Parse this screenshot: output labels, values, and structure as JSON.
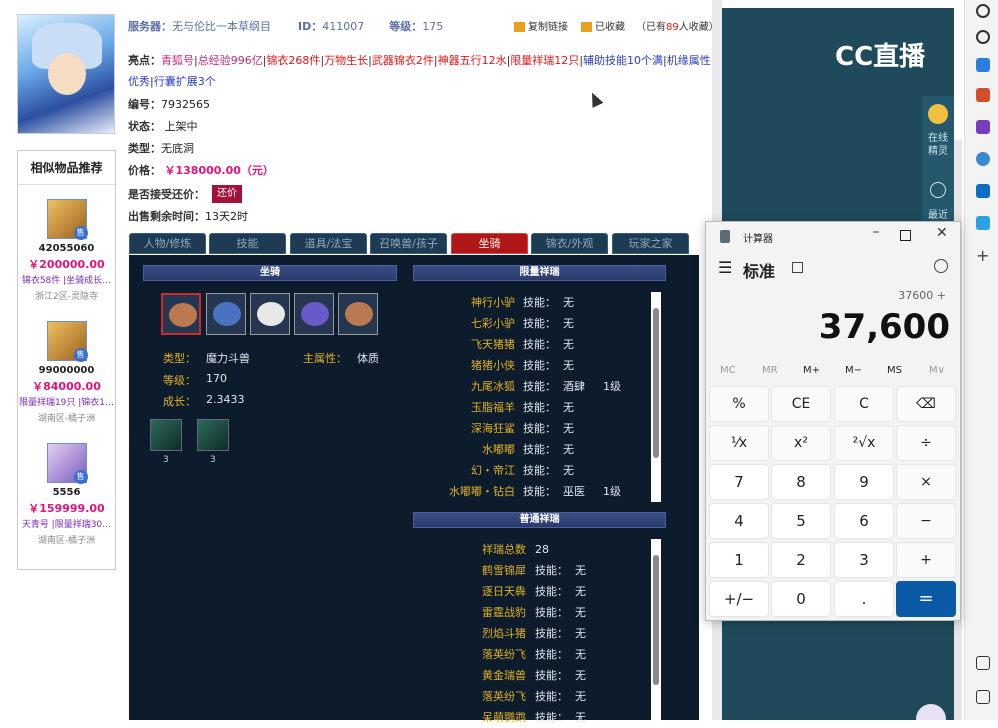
{
  "seller": {
    "server_label": "服务器：",
    "server": "无与伦比一本草纲目",
    "id_label": "ID：",
    "id": "411007",
    "level_label": "等级：",
    "level": "175",
    "copy_link": "复制链接",
    "favorited": "已收藏",
    "fav_count_pre": "（已有",
    "fav_count": "89",
    "fav_count_post": "人收藏）"
  },
  "item": {
    "highlights_label": "亮点：",
    "highlights": [
      "青狐号",
      "总经验996亿",
      "锦衣268件",
      "万物生长",
      "武器锦衣2件",
      "神器五行12水",
      "限量祥瑞12只",
      "辅助技能10个满",
      "机缘属性优秀",
      "行囊扩展3个"
    ],
    "number_label": "编号：",
    "number": "7932565",
    "status_label": "状态：",
    "status": "上架中",
    "type_label": "类型：",
    "type": "无底洞",
    "price_label": "价格：",
    "price": "￥138000.00（元）",
    "bargain_label": "是否接受还价：",
    "bargain_btn": "还价",
    "remaining_label": "出售剩余时间：",
    "remaining": "13天2时"
  },
  "similar": {
    "title": "相似物品推荐",
    "sale_badge": "售",
    "items": [
      {
        "id": "42055060",
        "price": "￥200000.00",
        "tags": "锦衣58件 |坐骑成长…",
        "loc": "浙江2区-灵隐寺"
      },
      {
        "id": "99000000",
        "price": "￥84000.00",
        "tags": "限量祥瑞19只 |锦衣1…",
        "loc": "湖南区-橘子洲"
      },
      {
        "id": "5556",
        "price": "￥159999.00",
        "tags": "天青号 |限量祥瑞30…",
        "loc": "湖南区-橘子洲"
      }
    ]
  },
  "tabs": [
    "人物/修炼",
    "技能",
    "道具/法宝",
    "召唤兽/孩子",
    "坐骑",
    "锦衣/外观",
    "玩家之家"
  ],
  "mount": {
    "header": "坐骑",
    "type_label": "类型：",
    "type": "魔力斗兽",
    "main_attr_label": "主属性：",
    "main_attr": "体质",
    "level_label": "等级：",
    "level": "170",
    "growth_label": "成长：",
    "growth": "2.3433",
    "skills": [
      "3",
      "3"
    ]
  },
  "limited": {
    "header": "限量祥瑞",
    "skill_label": "技能：",
    "rows": [
      {
        "name": "神行小驴",
        "skill": "无",
        "lvl": ""
      },
      {
        "name": "七彩小驴",
        "skill": "无",
        "lvl": ""
      },
      {
        "name": "飞天猪猪",
        "skill": "无",
        "lvl": ""
      },
      {
        "name": "猪猪小侠",
        "skill": "无",
        "lvl": ""
      },
      {
        "name": "九尾冰狐",
        "skill": "酒肆",
        "lvl": "1级"
      },
      {
        "name": "玉脂福羊",
        "skill": "无",
        "lvl": ""
      },
      {
        "name": "深海狂鲨",
        "skill": "无",
        "lvl": ""
      },
      {
        "name": "水嘟嘟",
        "skill": "无",
        "lvl": ""
      },
      {
        "name": "幻・帝江",
        "skill": "无",
        "lvl": ""
      },
      {
        "name": "水嘟嘟・钻白",
        "skill": "巫医",
        "lvl": "1级"
      }
    ]
  },
  "normal": {
    "header": "普通祥瑞",
    "total_label": "祥瑞总数",
    "total": "28",
    "skill_label": "技能：",
    "rows": [
      {
        "name": "鹤雪锦犀",
        "skill": "无"
      },
      {
        "name": "逐日天犇",
        "skill": "无"
      },
      {
        "name": "雷霆战豹",
        "skill": "无"
      },
      {
        "name": "烈焰斗猪",
        "skill": "无"
      },
      {
        "name": "落英纷飞",
        "skill": "无"
      },
      {
        "name": "黄金瑞兽",
        "skill": "无"
      },
      {
        "name": "落英纷飞",
        "skill": "无"
      },
      {
        "name": "呆萌鹦鹉",
        "skill": "无"
      }
    ]
  },
  "stream": {
    "logo": "CC直播",
    "side_items": [
      "在线精灵",
      "最近"
    ]
  },
  "calculator": {
    "title": "计算器",
    "mode": "标准",
    "expression": "37600 +",
    "display": "37,600",
    "memory": [
      "MC",
      "MR",
      "M+",
      "M−",
      "MS",
      "M∨"
    ],
    "keys": [
      [
        "%",
        "CE",
        "C",
        "⌫"
      ],
      [
        "¹⁄x",
        "x²",
        "²√x",
        "÷"
      ],
      [
        "7",
        "8",
        "9",
        "×"
      ],
      [
        "4",
        "5",
        "6",
        "−"
      ],
      [
        "1",
        "2",
        "3",
        "+"
      ],
      [
        "+/−",
        "0",
        ".",
        "="
      ]
    ]
  },
  "colors": {
    "accent": "#a3123a",
    "tab_active": "#b01818",
    "calc_equals": "#0a5aa8",
    "price": "#e0137a",
    "stream_bg": "#1e4a5c"
  }
}
